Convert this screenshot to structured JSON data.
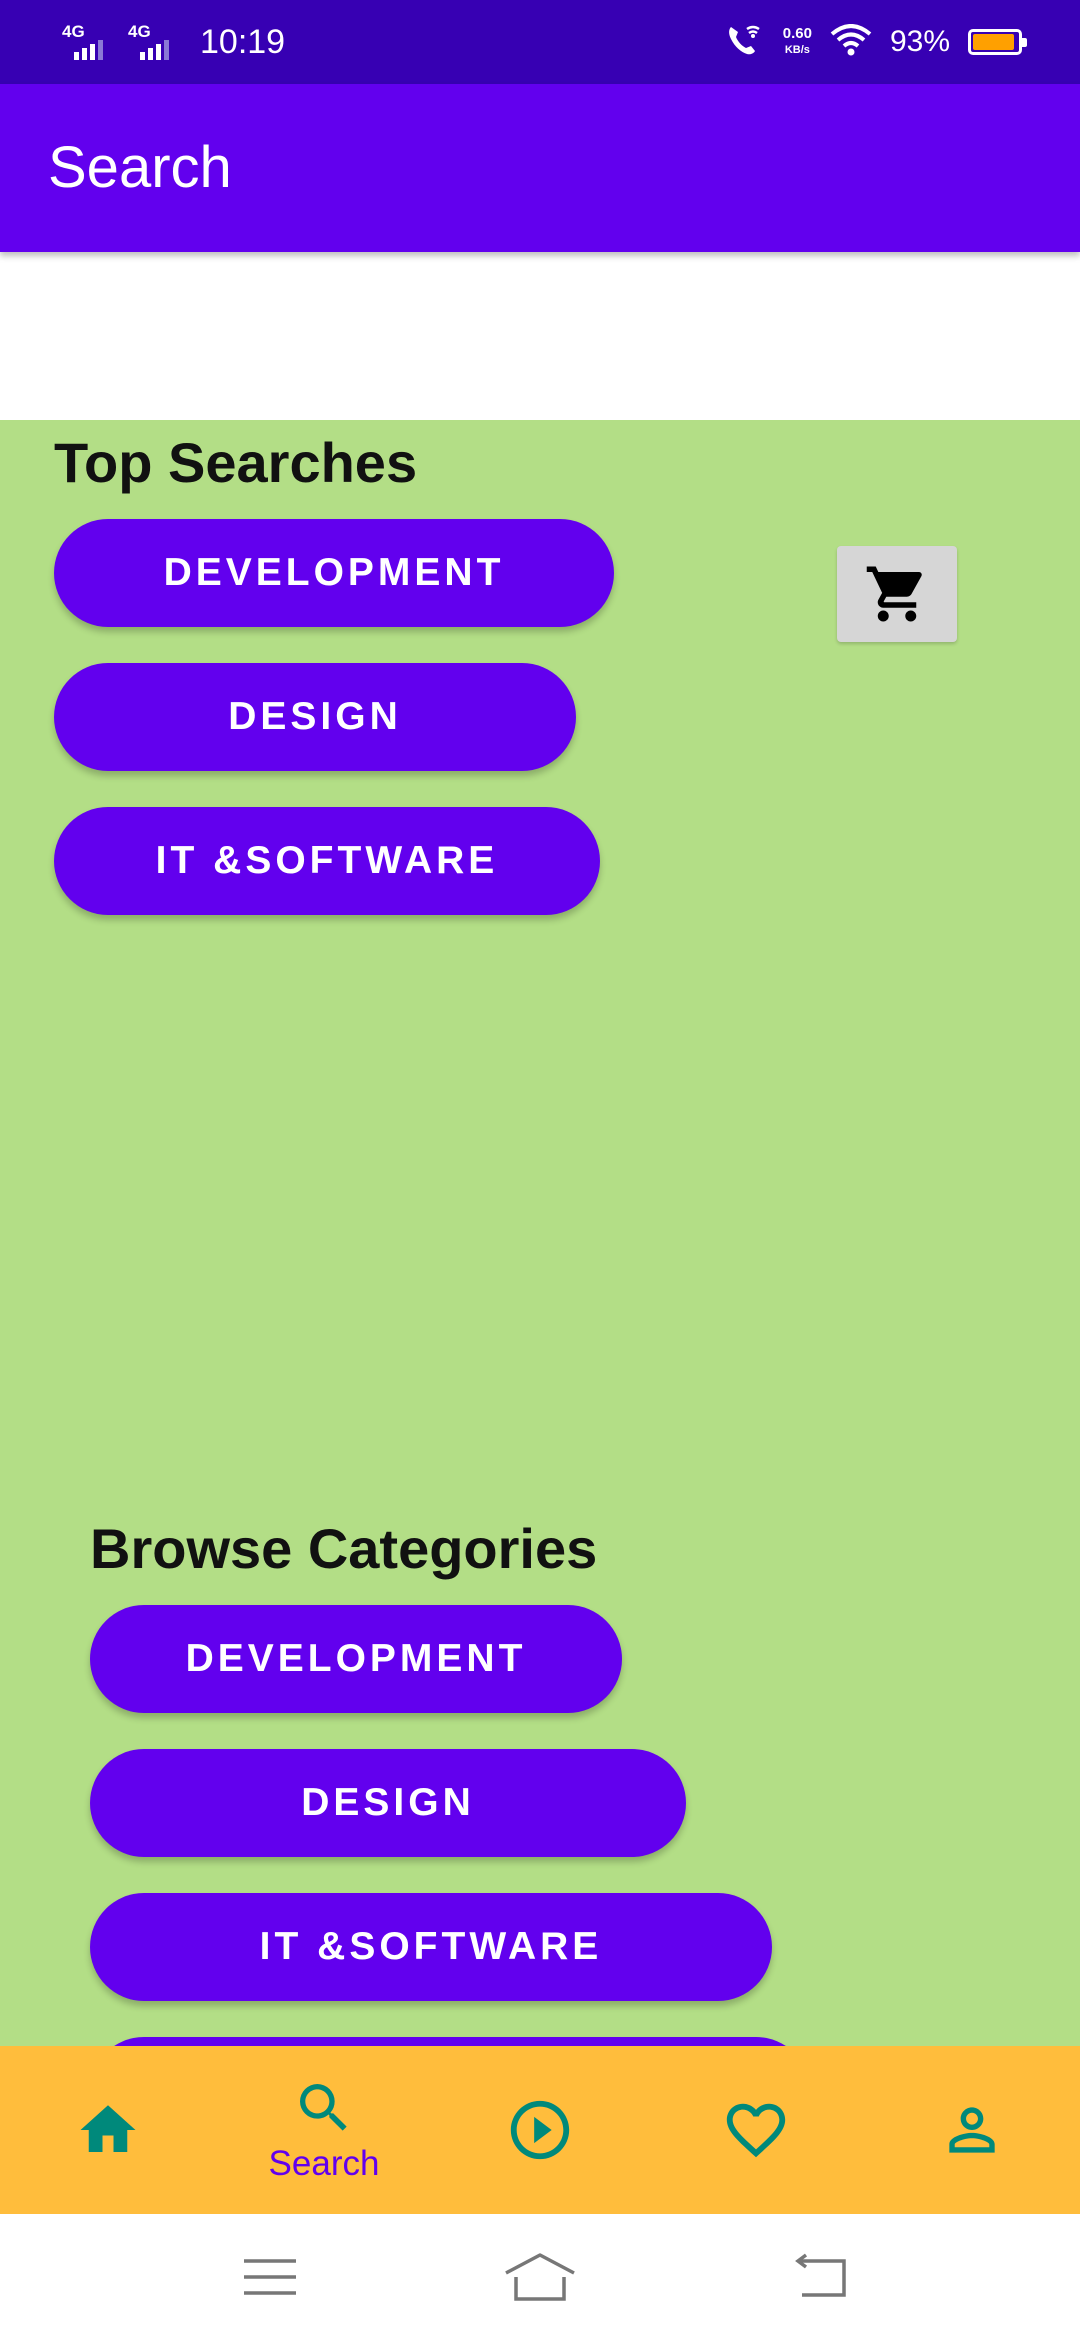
{
  "status_bar": {
    "network_1": "4G",
    "network_2": "4G",
    "time": "10:19",
    "net_speed_value": "0.60",
    "net_speed_unit": "KB/s",
    "battery_percent": "93%",
    "battery_level": 0.93,
    "icons": [
      "signal-icon",
      "signal-icon",
      "wifi-calling-icon",
      "wifi-icon",
      "battery-icon"
    ]
  },
  "app_bar": {
    "title": "Search"
  },
  "top_searches": {
    "title": "Top Searches",
    "buttons": [
      "DEVELOPMENT",
      "DESIGN",
      "IT &SOFTWARE"
    ],
    "cart_icon": "cart-icon"
  },
  "browse_categories": {
    "title": "Browse Categories",
    "buttons": [
      "DEVELOPMENT",
      "DESIGN",
      "IT &SOFTWARE"
    ]
  },
  "bottom_nav": {
    "items": [
      {
        "icon": "home-icon",
        "label": ""
      },
      {
        "icon": "search-icon",
        "label": "Search"
      },
      {
        "icon": "play-icon",
        "label": ""
      },
      {
        "icon": "heart-icon",
        "label": ""
      },
      {
        "icon": "profile-icon",
        "label": ""
      }
    ],
    "active_index": 1
  },
  "system_nav": {
    "icons": [
      "menu-icon",
      "home-outline-icon",
      "back-icon"
    ]
  },
  "colors": {
    "status_bar": "#3700B3",
    "primary": "#6200EE",
    "background_green": "#B3DE86",
    "bottom_nav": "#FFBD3C",
    "nav_icon": "#00897B"
  }
}
